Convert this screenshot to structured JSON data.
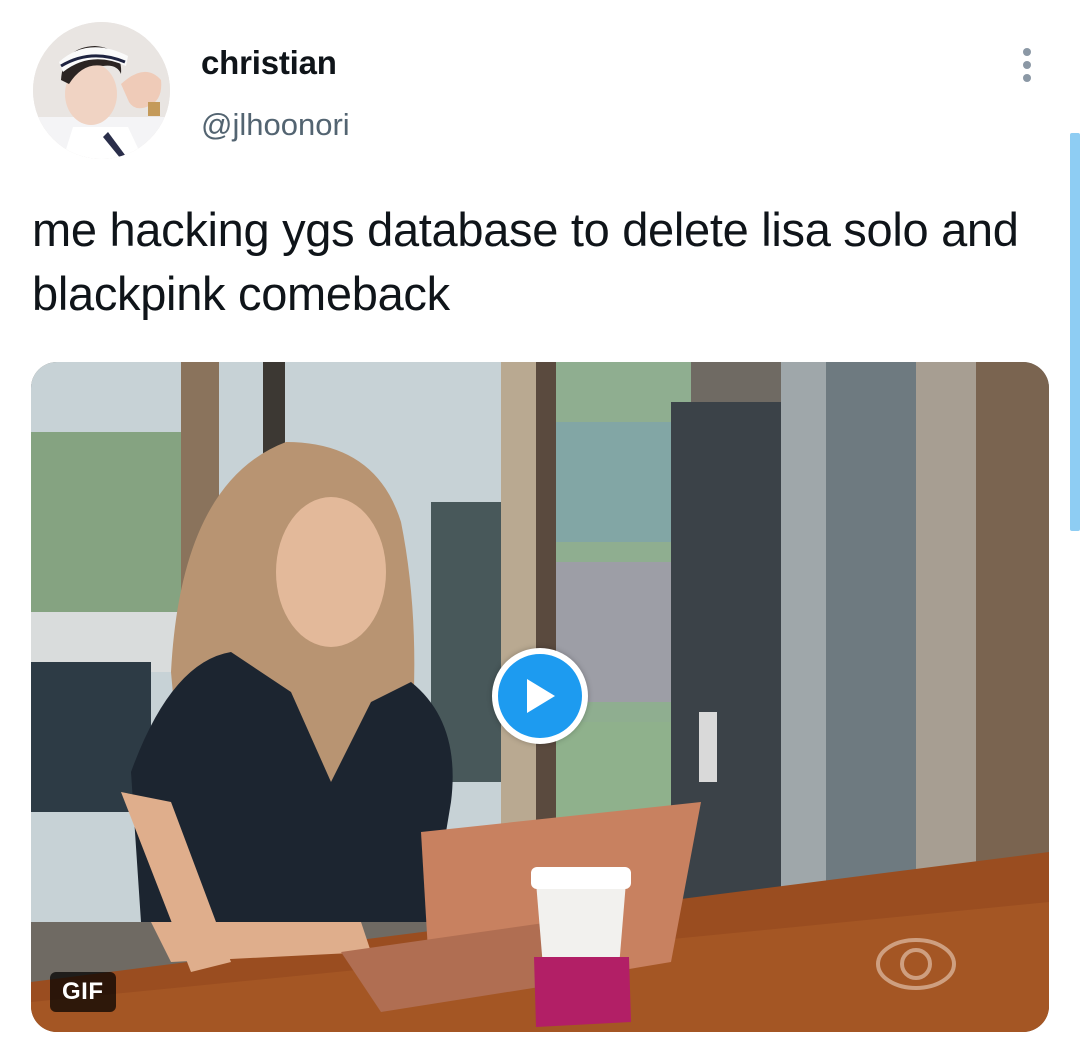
{
  "tweet": {
    "author": {
      "display_name": "christian",
      "handle": "@jlhoonori"
    },
    "text": "me hacking ygs database to delete lisa solo and blackpink comeback",
    "media": {
      "type": "gif",
      "badge_label": "GIF",
      "play_icon": "play-icon"
    }
  },
  "colors": {
    "accent": "#1d9bf0",
    "text_primary": "#0f1419",
    "text_secondary": "#536471"
  }
}
